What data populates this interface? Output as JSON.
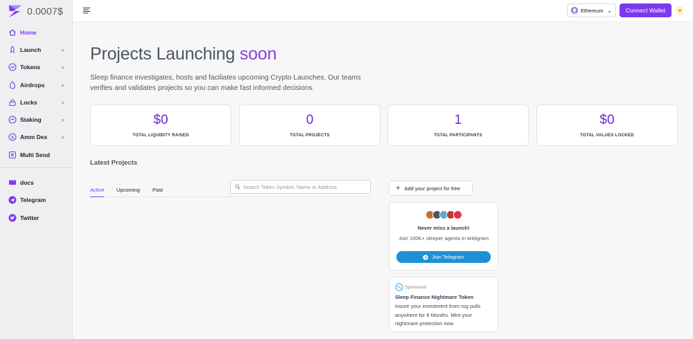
{
  "brand": {
    "price": "0.0007$"
  },
  "sidebar": {
    "items": [
      {
        "label": "Home",
        "icon": "home-icon",
        "active": true,
        "chevron": false
      },
      {
        "label": "Launch",
        "icon": "rocket-icon",
        "chevron": true
      },
      {
        "label": "Tokens",
        "icon": "trending-icon",
        "chevron": true
      },
      {
        "label": "Airdrops",
        "icon": "airdrop-icon",
        "chevron": true
      },
      {
        "label": "Locks",
        "icon": "lock-icon",
        "chevron": true
      },
      {
        "label": "Staking",
        "icon": "staking-icon",
        "chevron": true
      },
      {
        "label": "Amm Dex",
        "icon": "dex-icon",
        "chevron": true
      },
      {
        "label": "Multi Send",
        "icon": "multisend-icon",
        "chevron": false
      }
    ],
    "links": [
      {
        "label": "docs",
        "icon": "book-icon"
      },
      {
        "label": "Telegram",
        "icon": "telegram-icon"
      },
      {
        "label": "Twitter",
        "icon": "twitter-icon"
      }
    ],
    "chevron_glyph": "›"
  },
  "topbar": {
    "chain": "Ethereum",
    "chain_chevron": "⌄",
    "connect_label": "Connect Wallet"
  },
  "hero": {
    "title_main": "Projects Launching ",
    "title_accent": "soon",
    "description": "Sleep finance investigates, hosts and faciliates upcoming Crypto Launches. Our teams verifies and validates projects so you can make fast informed decisions."
  },
  "stats": [
    {
      "value": "$0",
      "label": "TOTAL LIQUIDITY RAISED"
    },
    {
      "value": "0",
      "label": "TOTAL PROJECTS"
    },
    {
      "value": "1",
      "label": "TOTAL PARTICIPANTS"
    },
    {
      "value": "$0",
      "label": "TOTAL VALUES LOCKED"
    }
  ],
  "latest": {
    "title": "Latest Projects",
    "tabs": [
      "Active",
      "Upcoming",
      "Past"
    ],
    "search_placeholder": "Search Token Symbol, Name or Address"
  },
  "add_project": {
    "plus": "+",
    "label": "Add your project for free"
  },
  "telegram_card": {
    "title": "Never miss a launch!",
    "subtitle": "Join 100K+ sleeper agents in telelgram",
    "button": "Join Telegram"
  },
  "sponsored_card": {
    "label": "Sponsored",
    "title": "Sleep Finance Nightmare Token",
    "body": "Insure your investment from rug pulls anywhere for 6 Months. Mint your nightmare protection now"
  },
  "colors": {
    "accent": "#7c3aed",
    "telegram": "#1e90d8",
    "avatars": [
      "#c2712f",
      "#4b5563",
      "#5fa8d3",
      "#c0392b",
      "#e0314f"
    ]
  }
}
